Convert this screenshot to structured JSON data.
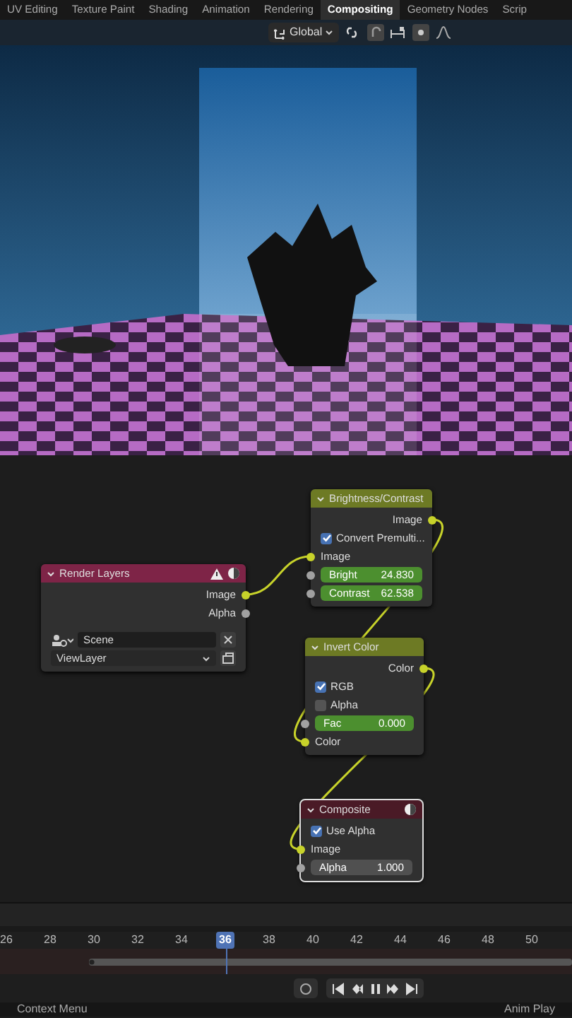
{
  "workspace_tabs": [
    {
      "label": "UV Editing",
      "selected": false
    },
    {
      "label": "Texture Paint",
      "selected": false
    },
    {
      "label": "Shading",
      "selected": false
    },
    {
      "label": "Animation",
      "selected": false
    },
    {
      "label": "Rendering",
      "selected": false
    },
    {
      "label": "Compositing",
      "selected": true
    },
    {
      "label": "Geometry Nodes",
      "selected": false
    },
    {
      "label": "Scrip",
      "selected": false
    }
  ],
  "header": {
    "orientation": "Global"
  },
  "nodes": [
    {
      "title": "Brightness/Contrast",
      "kind": "filter",
      "color": "#6d7a24",
      "rows": [
        {
          "kind": "output",
          "label": "Image",
          "color": "#c7d22a"
        },
        {
          "kind": "checkbox",
          "label": "Convert Premulti...",
          "checked": true
        },
        {
          "kind": "input",
          "label": "Image",
          "color": "#c7d22a"
        },
        {
          "kind": "slider",
          "label": "Bright",
          "value": "24.830",
          "color": "#a1a1a1"
        },
        {
          "kind": "slider",
          "label": "Contrast",
          "value": "62.538",
          "color": "#a1a1a1"
        }
      ]
    },
    {
      "title": "Render Layers",
      "kind": "input",
      "color": "#7e2447",
      "rows": [
        {
          "kind": "output",
          "label": "Image",
          "color": "#c7d22a"
        },
        {
          "kind": "output",
          "label": "Alpha",
          "color": "#a1a1a1"
        },
        {
          "kind": "scene",
          "value": "Scene"
        },
        {
          "kind": "dropdown",
          "value": "ViewLayer"
        }
      ]
    },
    {
      "title": "Invert Color",
      "kind": "filter",
      "color": "#6d7a24",
      "rows": [
        {
          "kind": "output",
          "label": "Color",
          "color": "#c7d22a"
        },
        {
          "kind": "checkbox",
          "label": "RGB",
          "checked": true
        },
        {
          "kind": "checkbox",
          "label": "Alpha",
          "checked": false
        },
        {
          "kind": "slider",
          "label": "Fac",
          "value": "0.000",
          "color": "#a1a1a1"
        },
        {
          "kind": "input",
          "label": "Color",
          "color": "#c7d22a"
        }
      ]
    },
    {
      "title": "Composite",
      "kind": "output",
      "color": "#4a1a26",
      "rows": [
        {
          "kind": "checkbox",
          "label": "Use Alpha",
          "checked": true
        },
        {
          "kind": "input",
          "label": "Image",
          "color": "#c7d22a"
        },
        {
          "kind": "number",
          "label": "Alpha",
          "value": "1.000",
          "color": "#a1a1a1"
        }
      ]
    }
  ],
  "timeline": {
    "frames": [
      {
        "label": "26",
        "selected": false
      },
      {
        "label": "28",
        "selected": false
      },
      {
        "label": "30",
        "selected": false
      },
      {
        "label": "32",
        "selected": false
      },
      {
        "label": "34",
        "selected": false
      },
      {
        "label": "36",
        "selected": true
      },
      {
        "label": "38",
        "selected": false
      },
      {
        "label": "40",
        "selected": false
      },
      {
        "label": "42",
        "selected": false
      },
      {
        "label": "44",
        "selected": false
      },
      {
        "label": "46",
        "selected": false
      },
      {
        "label": "48",
        "selected": false
      },
      {
        "label": "50",
        "selected": false
      }
    ]
  },
  "status_bar": [
    "Context Menu",
    "Anim Play"
  ]
}
